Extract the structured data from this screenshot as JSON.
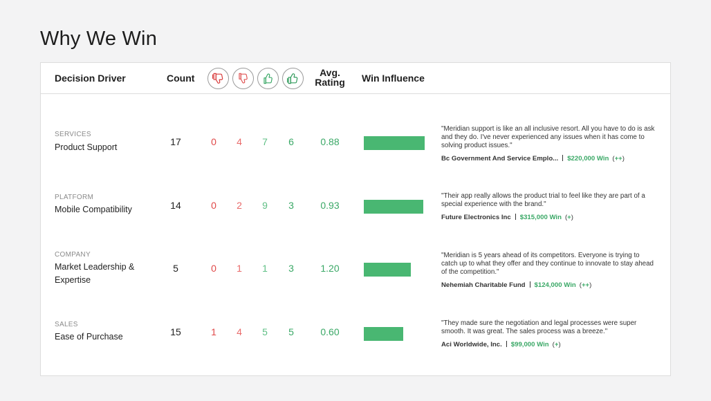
{
  "page": {
    "title": "Why We Win"
  },
  "table": {
    "headers": {
      "driver": "Decision Driver",
      "count": "Count",
      "avg_line1": "Avg.",
      "avg_line2": "Rating",
      "win_influence": "Win Influence"
    },
    "icons": [
      "strongly-negative-thumbs-down-icon",
      "negative-thumbs-down-icon",
      "positive-thumbs-up-icon",
      "strongly-positive-thumbs-up-icon"
    ],
    "colors": {
      "negative_strong": "#e04848",
      "negative": "#e96a6a",
      "positive": "#5fbf85",
      "positive_strong": "#3aa866",
      "bar": "#49b772"
    },
    "rows": [
      {
        "category": "SERVICES",
        "name": "Product Support",
        "count": "17",
        "ratings": [
          "0",
          "4",
          "7",
          "6"
        ],
        "avg": "0.88",
        "influence": 1.0,
        "quote": "\"Meridian support is like an all inclusive resort. All you have to do is ask and they do. I've never experienced any issues when it has come to solving product issues.\"",
        "account": "Bc Government And Service Emplo...",
        "amount": "$220,000 Win",
        "badge": "++"
      },
      {
        "category": "PLATFORM",
        "name": "Mobile Compatibility",
        "count": "14",
        "ratings": [
          "0",
          "2",
          "9",
          "3"
        ],
        "avg": "0.93",
        "influence": 0.98,
        "quote": "\"Their app really allows the product trial to feel like they are part of a special experience with the brand.\"",
        "account": "Future Electronics Inc",
        "amount": "$315,000 Win",
        "badge": "+"
      },
      {
        "category": "COMPANY",
        "name": "Market Leadership & Expertise",
        "count": "5",
        "ratings": [
          "0",
          "1",
          "1",
          "3"
        ],
        "avg": "1.20",
        "influence": 0.77,
        "quote": "\"Meridian is 5 years ahead of its competitors. Everyone is trying to catch up to what they offer and they continue to innovate to stay ahead of the competition.\"",
        "account": "Nehemiah Charitable Fund",
        "amount": "$124,000 Win",
        "badge": "++"
      },
      {
        "category": "SALES",
        "name": "Ease of Purchase",
        "count": "15",
        "ratings": [
          "1",
          "4",
          "5",
          "5"
        ],
        "avg": "0.60",
        "influence": 0.65,
        "quote": "\"They made sure the negotiation and legal processes were super smooth. It was great. The sales process was a breeze.\"",
        "account": "Aci Worldwide, Inc.",
        "amount": "$99,000 Win",
        "badge": "+"
      }
    ]
  }
}
